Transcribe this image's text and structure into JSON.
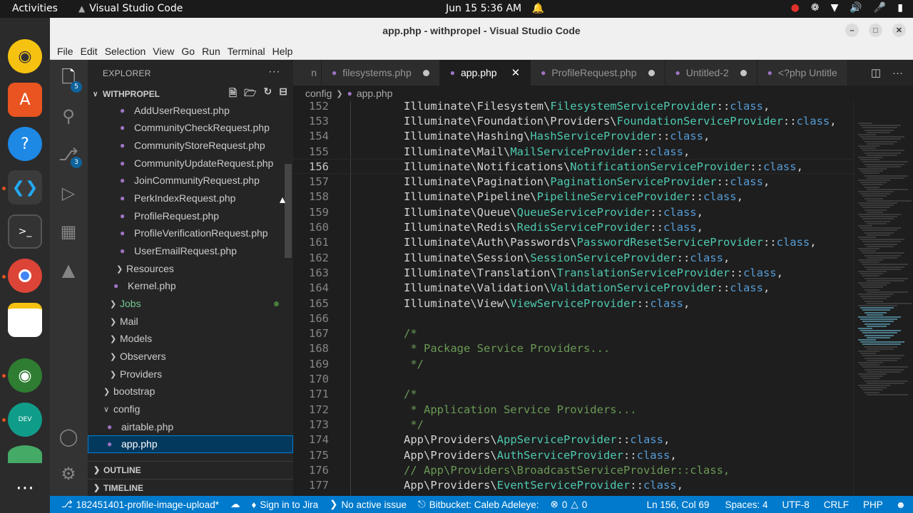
{
  "topbar": {
    "activities": "Activities",
    "app_name": "Visual Studio Code",
    "clock": "Jun 15  5:36 AM"
  },
  "window": {
    "title": "app.php - withpropel - Visual Studio Code"
  },
  "menu": [
    "File",
    "Edit",
    "Selection",
    "View",
    "Go",
    "Run",
    "Terminal",
    "Help"
  ],
  "activity_bar": {
    "explorer_badge": "5",
    "scm_badge": "3"
  },
  "explorer": {
    "header": "EXPLORER",
    "project": "WITHPROPEL",
    "rows": [
      {
        "label": "AddUserRequest.php",
        "type": "file"
      },
      {
        "label": "CommunityCheckRequest.php",
        "type": "file"
      },
      {
        "label": "CommunityStoreRequest.php",
        "type": "file"
      },
      {
        "label": "CommunityUpdateRequest.php",
        "type": "file"
      },
      {
        "label": "JoinCommunityRequest.php",
        "type": "file"
      },
      {
        "label": "PerkIndexRequest.php",
        "type": "file"
      },
      {
        "label": "ProfileRequest.php",
        "type": "file"
      },
      {
        "label": "ProfileVerificationRequest.php",
        "type": "file"
      },
      {
        "label": "UserEmailRequest.php",
        "type": "file"
      },
      {
        "label": "Resources",
        "type": "folder"
      },
      {
        "label": "Kernel.php",
        "type": "file"
      },
      {
        "label": "Jobs",
        "type": "folder"
      },
      {
        "label": "Mail",
        "type": "folder"
      },
      {
        "label": "Models",
        "type": "folder"
      },
      {
        "label": "Observers",
        "type": "folder"
      },
      {
        "label": "Providers",
        "type": "folder"
      },
      {
        "label": "bootstrap",
        "type": "folder"
      },
      {
        "label": "config",
        "type": "folder-open"
      },
      {
        "label": "airtable.php",
        "type": "file"
      },
      {
        "label": "app.php",
        "type": "file"
      }
    ],
    "outline": "OUTLINE",
    "timeline": "TIMELINE"
  },
  "tabs": [
    {
      "label": "n",
      "state": "partial"
    },
    {
      "label": "filesystems.php",
      "state": "modified"
    },
    {
      "label": "app.php",
      "state": "active"
    },
    {
      "label": "ProfileRequest.php",
      "state": "modified"
    },
    {
      "label": "Untitled-2",
      "state": "modified"
    },
    {
      "label": "<?php  Untitle",
      "state": "partial"
    }
  ],
  "breadcrumb": {
    "folder": "config",
    "file": "app.php"
  },
  "code_lines": [
    {
      "n": "152",
      "text": "Illuminate\\Filesystem\\FilesystemServiceProvider::class,"
    },
    {
      "n": "153",
      "text": "Illuminate\\Foundation\\Providers\\FoundationServiceProvider::class,"
    },
    {
      "n": "154",
      "text": "Illuminate\\Hashing\\HashServiceProvider::class,"
    },
    {
      "n": "155",
      "text": "Illuminate\\Mail\\MailServiceProvider::class,"
    },
    {
      "n": "156",
      "text": "Illuminate\\Notifications\\NotificationServiceProvider::class,"
    },
    {
      "n": "157",
      "text": "Illuminate\\Pagination\\PaginationServiceProvider::class,"
    },
    {
      "n": "158",
      "text": "Illuminate\\Pipeline\\PipelineServiceProvider::class,"
    },
    {
      "n": "159",
      "text": "Illuminate\\Queue\\QueueServiceProvider::class,"
    },
    {
      "n": "160",
      "text": "Illuminate\\Redis\\RedisServiceProvider::class,"
    },
    {
      "n": "161",
      "text": "Illuminate\\Auth\\Passwords\\PasswordResetServiceProvider::class,"
    },
    {
      "n": "162",
      "text": "Illuminate\\Session\\SessionServiceProvider::class,"
    },
    {
      "n": "163",
      "text": "Illuminate\\Translation\\TranslationServiceProvider::class,"
    },
    {
      "n": "164",
      "text": "Illuminate\\Validation\\ValidationServiceProvider::class,"
    },
    {
      "n": "165",
      "text": "Illuminate\\View\\ViewServiceProvider::class,"
    },
    {
      "n": "166",
      "text": ""
    },
    {
      "n": "167",
      "text": "/*"
    },
    {
      "n": "168",
      "text": " * Package Service Providers..."
    },
    {
      "n": "169",
      "text": " */"
    },
    {
      "n": "170",
      "text": ""
    },
    {
      "n": "171",
      "text": "/*"
    },
    {
      "n": "172",
      "text": " * Application Service Providers..."
    },
    {
      "n": "173",
      "text": " */"
    },
    {
      "n": "174",
      "text": "App\\Providers\\AppServiceProvider::class,"
    },
    {
      "n": "175",
      "text": "App\\Providers\\AuthServiceProvider::class,"
    },
    {
      "n": "176",
      "text": "// App\\Providers\\BroadcastServiceProvider::class,"
    },
    {
      "n": "177",
      "text": "App\\Providers\\EventServiceProvider::class,"
    }
  ],
  "current_line": "156",
  "statusbar": {
    "branch": "182451401-profile-image-upload*",
    "jira": "Sign in to Jira",
    "issue": "No active issue",
    "bitbucket": "Bitbucket: Caleb Adeleye:",
    "errors": "0",
    "warnings": "0",
    "position": "Ln 156, Col 69",
    "spaces": "Spaces: 4",
    "encoding": "UTF-8",
    "eol": "CRLF",
    "language": "PHP"
  },
  "colors": {
    "accent": "#007acc",
    "class_name": "#4ec9b0",
    "keyword": "#569cd6",
    "comment": "#6a9955"
  }
}
